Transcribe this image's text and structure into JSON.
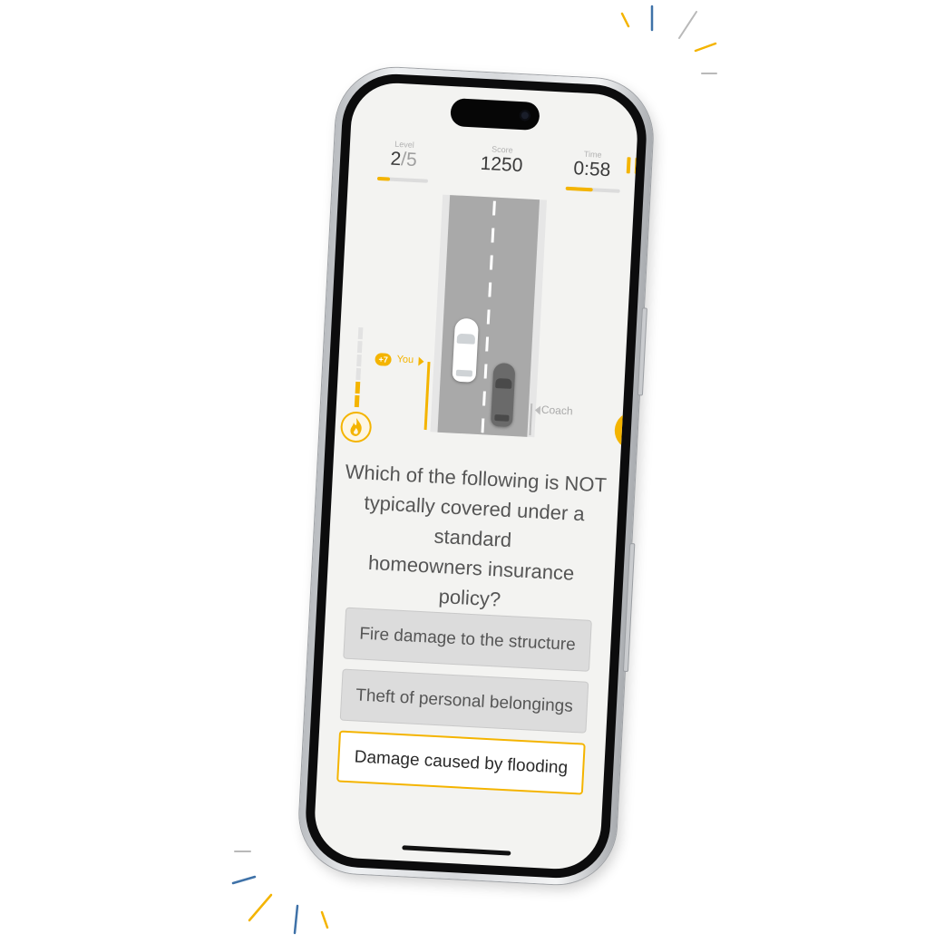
{
  "hud": {
    "level_caption": "Level",
    "level_current": "2",
    "level_total": "/5",
    "level_progress": 0.25,
    "score_caption": "Score",
    "score_value": "1250",
    "time_caption": "Time",
    "time_value": "0:58",
    "time_progress": 0.5,
    "pause_icon": "pause-icon"
  },
  "race": {
    "you_bonus": "+7",
    "you_label": "You",
    "coach_label": "Coach",
    "streak_segments_total": 6,
    "streak_segments_filled": 2,
    "streak_icon": "fire-icon",
    "hint_icon": "lightbulb-icon"
  },
  "question": {
    "line1": "Which of the following is NOT",
    "line2": "typically covered under a standard",
    "line3": "homeowners insurance policy?"
  },
  "answers": [
    {
      "label": "Fire damage to the structure",
      "state": "default"
    },
    {
      "label": "Theft of personal belongings",
      "state": "default"
    },
    {
      "label": "Damage caused by flooding",
      "state": "selected"
    }
  ],
  "colors": {
    "accent": "#f4b400",
    "screen_bg": "#f3f3f1",
    "road": "#a9a9a9",
    "answer_bg": "#dcdcdc",
    "burst_blue": "#3f72a8",
    "burst_yellow": "#f4b400",
    "burst_grey": "#b9b9b9"
  }
}
